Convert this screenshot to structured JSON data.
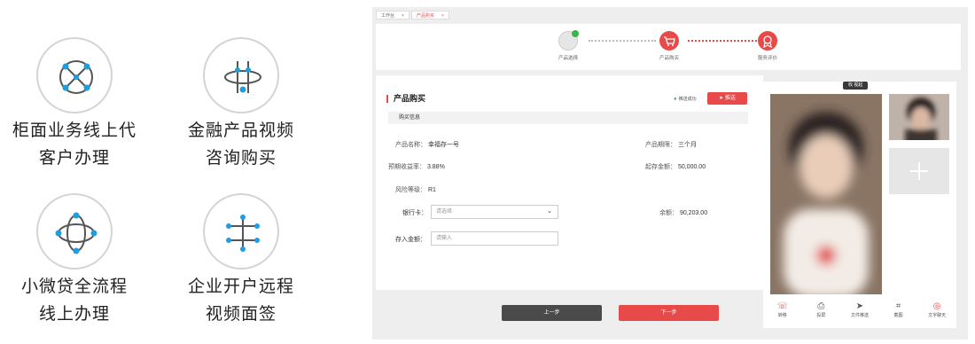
{
  "features": [
    {
      "line1": "柜面业务线上代",
      "line2": "客户办理",
      "icon": "network-x-icon"
    },
    {
      "line1": "金融产品视频",
      "line2": "咨询购买",
      "icon": "orbit-icon"
    },
    {
      "line1": "小微贷全流程",
      "line2": "线上办理",
      "icon": "flower-network-icon"
    },
    {
      "line1": "企业开户远程",
      "line2": "视频面签",
      "icon": "hub-icon"
    }
  ],
  "tabs": [
    {
      "label": "工作台",
      "close": "×"
    },
    {
      "label": "产品购买",
      "close": "×"
    }
  ],
  "steps": [
    {
      "label": "产品选择"
    },
    {
      "label": "产品购买"
    },
    {
      "label": "服务评价"
    }
  ],
  "card": {
    "title": "产品购买",
    "status": "推送成功",
    "push_label": "推送",
    "section": "购买信息",
    "name_key": "产品名称：",
    "name_val": "幸福存一号",
    "term_key": "产品期限：",
    "term_val": "三个月",
    "rate_key": "预期收益率：",
    "rate_val": "3.88%",
    "min_key": "起存金额：",
    "min_val": "50,000.00",
    "risk_key": "风险等级：",
    "risk_val": "R1",
    "bank_key": "银行卡：",
    "bank_placeholder": "请选择",
    "balance_key": "余额：",
    "balance_val": "90,203.00",
    "deposit_key": "存入金额：",
    "deposit_placeholder": "请输入"
  },
  "buttons": {
    "prev": "上一步",
    "next": "下一步"
  },
  "video": {
    "label": "收 视起",
    "tools": [
      "转移",
      "投屏",
      "文件推送",
      "截图",
      "文字聊天"
    ]
  },
  "colors": {
    "accent": "#e84a4a",
    "success": "#39b54a",
    "dark_button": "#4a4a4a"
  }
}
